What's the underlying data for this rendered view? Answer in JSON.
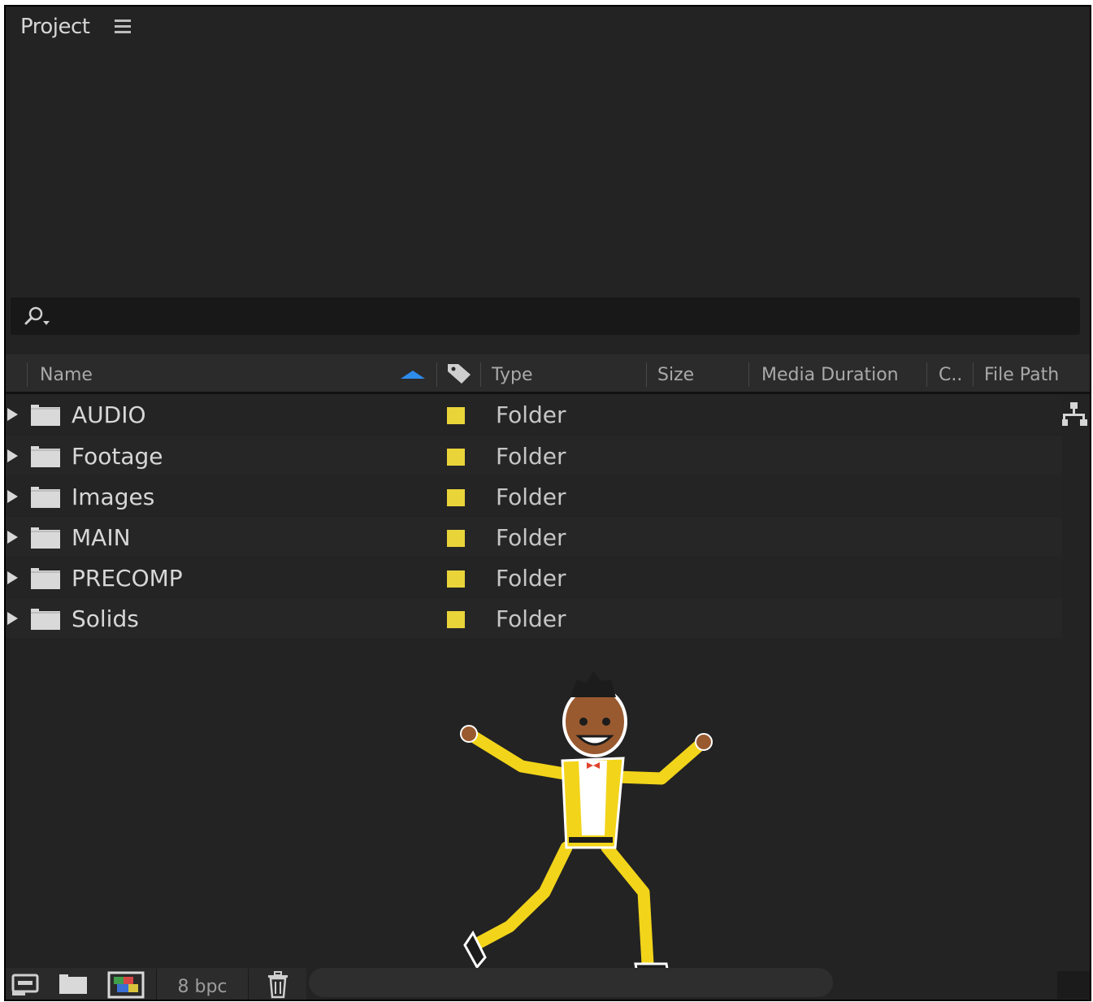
{
  "panel": {
    "title": "Project",
    "menu_icon": "hamburger-menu-icon"
  },
  "search": {
    "icon": "magnifier-dropdown-icon",
    "value": "",
    "placeholder": ""
  },
  "columns": [
    {
      "id": "name",
      "label": "Name",
      "sorted": "ascending"
    },
    {
      "id": "label",
      "icon": "tag-icon"
    },
    {
      "id": "type",
      "label": "Type"
    },
    {
      "id": "size",
      "label": "Size"
    },
    {
      "id": "media_duration",
      "label": "Media Duration"
    },
    {
      "id": "comment",
      "label": "C.."
    },
    {
      "id": "file_path",
      "label": "File Path"
    }
  ],
  "rows": [
    {
      "name": "AUDIO",
      "type": "Folder",
      "label_color": "#e9d43a"
    },
    {
      "name": "Footage",
      "type": "Folder",
      "label_color": "#e9d43a"
    },
    {
      "name": "Images",
      "type": "Folder",
      "label_color": "#e9d43a"
    },
    {
      "name": "MAIN",
      "type": "Folder",
      "label_color": "#e9d43a"
    },
    {
      "name": "PRECOMP",
      "type": "Folder",
      "label_color": "#e9d43a"
    },
    {
      "name": "Solids",
      "type": "Folder",
      "label_color": "#e9d43a"
    }
  ],
  "bottom_bar": {
    "interpret_footage_icon": "interpret-footage-icon",
    "new_folder_icon": "new-folder-icon",
    "new_composition_icon": "new-composition-icon",
    "bpc_label": "8 bpc",
    "delete_icon": "trash-icon"
  },
  "flowchart_icon": "flowchart-icon",
  "colors": {
    "panel_bg": "#232323",
    "accent_blue": "#2d8ceb",
    "label_yellow": "#e9d43a",
    "text": "#d7d7d7"
  }
}
